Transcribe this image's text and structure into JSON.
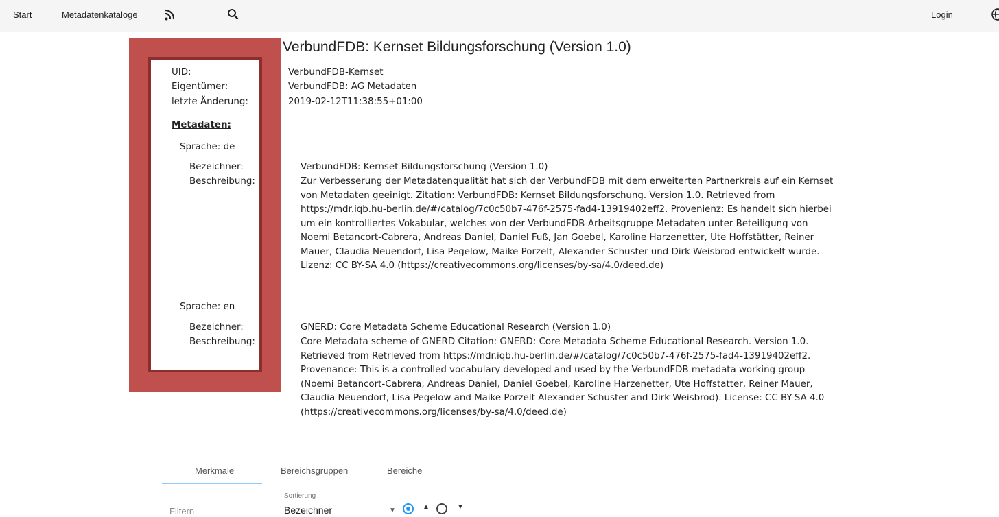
{
  "nav": {
    "start": "Start",
    "catalogs": "Metadatenkataloge",
    "login": "Login",
    "rss_icon": "rss-icon",
    "search_icon": "search-icon",
    "language_icon": "globe-icon"
  },
  "title": "VerbundFDB: Kernset Bildungsforschung (Version 1.0)",
  "meta": {
    "uid_label": "UID:",
    "uid_value": "VerbundFDB-Kernset",
    "owner_label": "Eigentümer:",
    "owner_value": "VerbundFDB: AG Metadaten",
    "changed_label": "letzte Änderung:",
    "changed_value": "2019-02-12T11:38:55+01:00"
  },
  "metadata_heading": "Metadaten:",
  "languages": [
    {
      "lang": "Sprache: de",
      "name_label": "Bezeichner:",
      "desc_label": "Beschreibung:",
      "name": "VerbundFDB: Kernset Bildungsforschung (Version 1.0)",
      "description": "Zur Verbesserung der Metadatenqualität hat sich der VerbundFDB mit dem erweiterten Partnerkreis auf ein Kernset von Metadaten geeinigt. Zitation: VerbundFDB: Kernset Bildungsforschung. Version 1.0. Retrieved from https://mdr.iqb.hu-berlin.de/#/catalog/7c0c50b7-476f-2575-fad4-13919402eff2. Provenienz: Es handelt sich hierbei um ein kontrolliertes Vokabular, welches von der VerbundFDB-Arbeitsgruppe Metadaten unter Beteiligung von Noemi Betancort-Cabrera, Andreas Daniel, Daniel Fuß, Jan Goebel, Karoline Harzenetter, Ute Hoffstätter, Reiner Mauer, Claudia Neuendorf, Lisa Pegelow, Maike Porzelt, Alexander Schuster und Dirk Weisbrod entwickelt wurde. Lizenz: CC BY-SA 4.0 (https://creativecommons.org/licenses/by-sa/4.0/deed.de)"
    },
    {
      "lang": "Sprache: en",
      "name_label": "Bezeichner:",
      "desc_label": "Beschreibung:",
      "name": "GNERD: Core Metadata Scheme Educational Research (Version 1.0)",
      "description": "Core Metadata scheme of GNERD Citation: GNERD: Core Metadata Scheme Educational Research. Version 1.0. Retrieved from Retrieved from https://mdr.iqb.hu-berlin.de/#/catalog/7c0c50b7-476f-2575-fad4-13919402eff2. Provenance: This is a controlled vocabulary developed and used by the VerbundFDB metadata working group (Noemi Betancort-Cabrera, Andreas Daniel, Daniel Goebel, Karoline Harzenetter, Ute Hoffstatter, Reiner Mauer, Claudia Neuendorf, Lisa Pegelow and Maike Porzelt Alexander Schuster and Dirk Weisbrod). License: CC BY-SA 4.0 (https://creativecommons.org/licenses/by-sa/4.0/deed.de)"
    }
  ],
  "tabs": [
    {
      "label": "Merkmale",
      "active": true
    },
    {
      "label": "Bereichsgruppen",
      "active": false
    },
    {
      "label": "Bereiche",
      "active": false
    }
  ],
  "filter_label": "Filtern",
  "sort": {
    "caption": "Sortierung",
    "value": "Bezeichner",
    "ascending_selected": true
  },
  "colors": {
    "highlight": "#c0504d",
    "accent": "#2196f3"
  }
}
